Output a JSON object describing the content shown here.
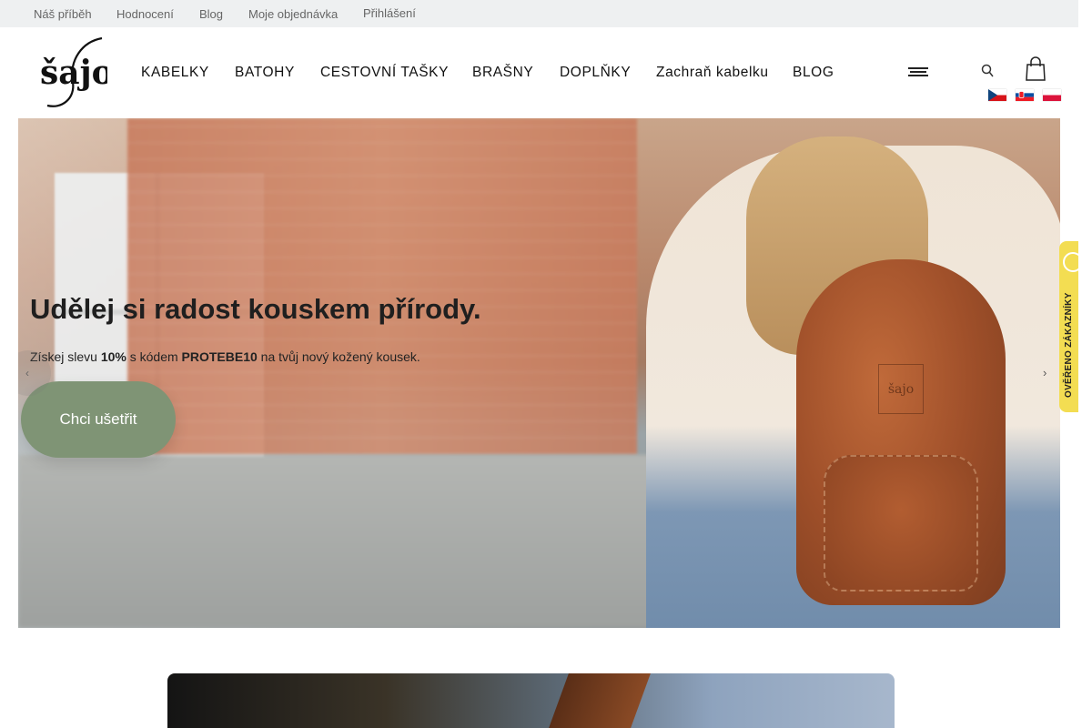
{
  "topbar": {
    "links": [
      "Náš příběh",
      "Hodnocení",
      "Blog",
      "Moje objednávka",
      "Přihlášení"
    ]
  },
  "header": {
    "logo_text": "šajo",
    "nav": [
      "KABELKY",
      "BATOHY",
      "CESTOVNÍ TAŠKY",
      "BRAŠNY",
      "DOPLŇKY",
      "Zachraň kabelku",
      "BLOG"
    ],
    "icons": {
      "menu": "hamburger-icon",
      "search": "search-icon",
      "cart": "shopping-bag-icon"
    },
    "flags": [
      "cz",
      "sk",
      "pl"
    ]
  },
  "hero": {
    "title": "Udělej si radost kouskem přírody.",
    "subtitle_prefix": "Získej slevu ",
    "discount": "10%",
    "subtitle_mid": " s kódem ",
    "code": "PROTEBE10",
    "subtitle_suffix": " na tvůj nový kožený kousek.",
    "cta_label": "Chci ušetřit",
    "backpack_logo": "šajo"
  },
  "verified_badge": {
    "text": "OVĚŘENO ZÁKAZNÍKY"
  },
  "colors": {
    "cta": "#7f9475",
    "topbar": "#eef0f1",
    "badge": "#f3dd52"
  }
}
